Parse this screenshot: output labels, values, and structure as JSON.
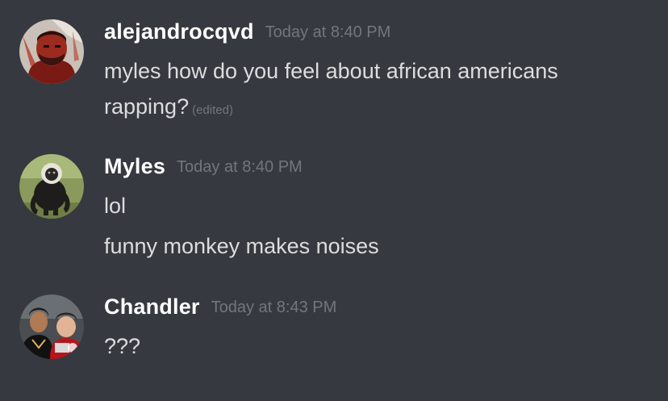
{
  "messages": [
    {
      "avatar_icon": "red-bearded-man-avatar-icon",
      "username": "alejandrocqvd",
      "timestamp": "Today at 8:40 PM",
      "lines": [
        "myles how do you feel about african americans",
        "rapping?"
      ],
      "edited_label": "(edited)"
    },
    {
      "avatar_icon": "monkey-avatar-icon",
      "username": "Myles",
      "timestamp": "Today at 8:40 PM",
      "lines": [
        "lol",
        "funny monkey makes noises"
      ]
    },
    {
      "avatar_icon": "two-people-photo-avatar-icon",
      "username": "Chandler",
      "timestamp": "Today at 8:43 PM",
      "lines": [
        "???"
      ]
    }
  ],
  "colors": {
    "background": "#36393f",
    "username": "#ffffff",
    "message_text": "#dcddde",
    "timestamp": "#72767d"
  }
}
